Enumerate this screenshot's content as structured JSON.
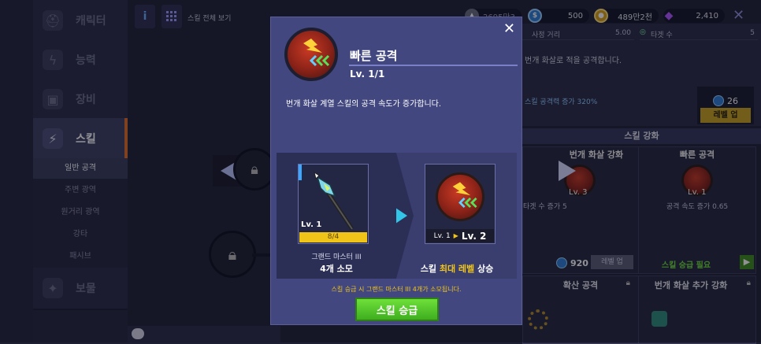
{
  "nav": {
    "items": [
      {
        "label": "캐릭터",
        "icon": "helmet-icon"
      },
      {
        "label": "능력",
        "icon": "lightning-icon"
      },
      {
        "label": "장비",
        "icon": "armor-icon"
      },
      {
        "label": "스킬",
        "icon": "claw-icon"
      },
      {
        "label": "보물",
        "icon": "sparkle-icon"
      }
    ],
    "sub_items": [
      "일반 공격",
      "주변 광역",
      "원거리 광역",
      "강타",
      "패시브"
    ]
  },
  "topbar": {
    "info_label": "i",
    "view_all_label": "스킬 전체 보기",
    "currency_power": "2695만3",
    "currency_blue": "500",
    "currency_gold": "489만2천",
    "currency_gem": "2,410",
    "close_label": "✕"
  },
  "detail": {
    "stat1_label": "사정 거리",
    "stat1_value": "5.00",
    "stat2_label": "타겟 수",
    "stat2_value": "5",
    "desc": "번개 화살로 적을 공격합니다.",
    "effect": "스킬 공격력 증가 320%",
    "cost": "26",
    "levelup_label": "레벨 업"
  },
  "enhance": {
    "title": "스킬 강화",
    "cards": [
      {
        "title": "번개 화살 강화",
        "level": "Lv. 3",
        "desc": "타겟 수 증가 5",
        "cost": "920",
        "button": "레벨 업"
      },
      {
        "title": "빠른 공격",
        "level": "Lv. 1",
        "desc": "공격 속도 증가 0.65",
        "button": "스킬 승급 필요"
      }
    ],
    "locked": [
      "확산 공격",
      "번개 화살 추가 강화"
    ]
  },
  "modal": {
    "title": "빠른 공격",
    "level": "Lv. 1/1",
    "description": "번개 화살 계열 스킬의 공격 속도가 증가합니다.",
    "material_level": "Lv. 1",
    "material_count": "8/4",
    "material_name": "그랜드 마스터 III",
    "material_cost": "4개 소모",
    "result_from": "Lv. 1",
    "result_to": "Lv. 2",
    "result_text_pre": "스킬",
    "result_text_em": "최대 레벨",
    "result_text_post": "상승",
    "notice": "스킬 승급 시 그랜드 마스터 III 4개가 소모됩니다.",
    "upgrade_button": "스킬 승급",
    "close_label": "✕"
  },
  "colors": {
    "accent_orange": "#e2702a",
    "modal_bg": "#424780",
    "notice_yellow": "#f0c419",
    "green_button": "#4fc426"
  }
}
